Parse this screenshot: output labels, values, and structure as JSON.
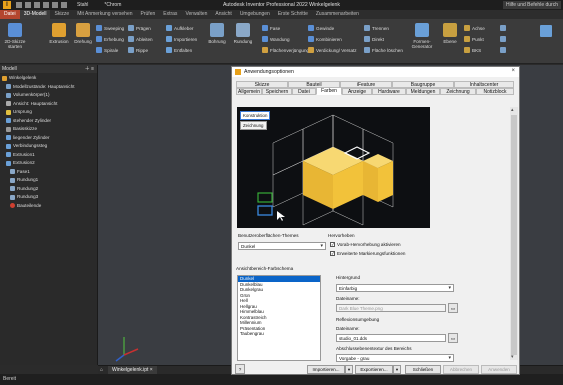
{
  "app": {
    "title": "Autodesk Inventor Professional 2022  Winkelgelenk",
    "help": "Hilfe und Befehle durch",
    "quick_access": {
      "material": "Stahl",
      "appearance": "*Chrom"
    },
    "file_tab": "Datei"
  },
  "ribbon_tabs": [
    "3D-Modell",
    "Skizze",
    "Mit Anmerkung versehen",
    "Prüfen",
    "Extras",
    "Verwalten",
    "Ansicht",
    "Umgebungen",
    "Erste Schritte",
    "Zusammenarbeiten"
  ],
  "ribbon": {
    "skizze": "2D-Skizze starten",
    "extrusion": "Extrusion",
    "drehung": "Drehung",
    "col1": [
      "Sweeping",
      "Erhebung",
      "Spirale"
    ],
    "col2": [
      "Prägen",
      "Ableiten",
      "Rippe"
    ],
    "col3": [
      "Aufkleber",
      "Importieren",
      "Entfalten"
    ],
    "bohrung": "Bohrung",
    "rundung": "Rundung",
    "col4": [
      "Fase",
      "Wandung",
      "Flächenverjüngung"
    ],
    "col5": [
      "Gewinde",
      "Kombinieren",
      "Verdickung/ Versatz"
    ],
    "col6": [
      "Trennen",
      "Direkt",
      "Fläche löschen"
    ],
    "formen": "Formen-Generator",
    "ebene": "Ebene",
    "col7": [
      "Achse",
      "Punkt",
      "BKS"
    ],
    "groups": [
      "Skizze",
      "Erstellen",
      "Ändern",
      "Untersuchen",
      "Arbeitselemente",
      "Muster",
      "Freifo"
    ]
  },
  "browser": {
    "title": "Modell",
    "items": [
      "Winkelgelenk",
      "Modellzustände: Hauptansicht",
      "Volumenkörper(1)",
      "Ansicht: Hauptansicht",
      "Ursprung",
      "stehender Zylinder",
      "Basisskizze",
      "liegender Zylinder",
      "Verbindungssteg",
      "Extrusion1",
      "Extrusion2",
      "Fase1",
      "Rundung1",
      "Rundung2",
      "Rundung3",
      "Bauteilende"
    ]
  },
  "doc_tab": "Winkelgelenk.ipt",
  "status_bar": "Bereit",
  "dialog": {
    "title": "Anwendungsoptionen",
    "tabs_row1": [
      "Skizze",
      "Bauteil",
      "iFeature",
      "Baugruppe",
      "Inhaltscenter"
    ],
    "tabs_row2": [
      "Allgemein",
      "Speichern",
      "Datei",
      "Farben",
      "Anzeige",
      "Hardware",
      "Meldungen",
      "Zeichnung",
      "Notizblock"
    ],
    "selected_tab": "Farben",
    "scheme_buttons": [
      "Konstruktion",
      "Zeichnung"
    ],
    "ui_theme_label": "Benutzeroberflächen-Themes",
    "ui_theme_value": "Dunkel",
    "highlight_label": "Hervorheben",
    "highlight_checks": [
      "Vorab-Hervorhebung aktivieren",
      "Erweiterte Markierungsfunktionen"
    ],
    "color_scheme_label": "Ansichtbereich-Farbschema",
    "color_schemes": [
      "Dunkel",
      "Dunkelblau",
      "Dunkelgrau",
      "Grün",
      "Hell",
      "Hellgrau",
      "Himmelblau",
      "Kontrastreich",
      "Millennium",
      "Präsentation",
      "Taubengrau"
    ],
    "background_label": "Hintergrund",
    "background_value": "Einfarbig",
    "filename_label": "Dateiname:",
    "filename_value": "Dark Blue Theme.png",
    "reflection_label": "Reflexionsumgebung",
    "reflection_file_label": "Dateiname:",
    "reflection_file_value": "studio_01.dds",
    "section_label": "Abschlussebenentextur des Bereichs",
    "section_value": "Vorgabe - grau",
    "footer_buttons": [
      "Importieren...",
      "Exportieren...",
      "Schließen",
      "Abbrechen",
      "Anwenden"
    ]
  },
  "colors": {
    "accent": "#0a64c8",
    "file_tab": "#b4462e",
    "cube_yellow": "#f2c23a"
  }
}
